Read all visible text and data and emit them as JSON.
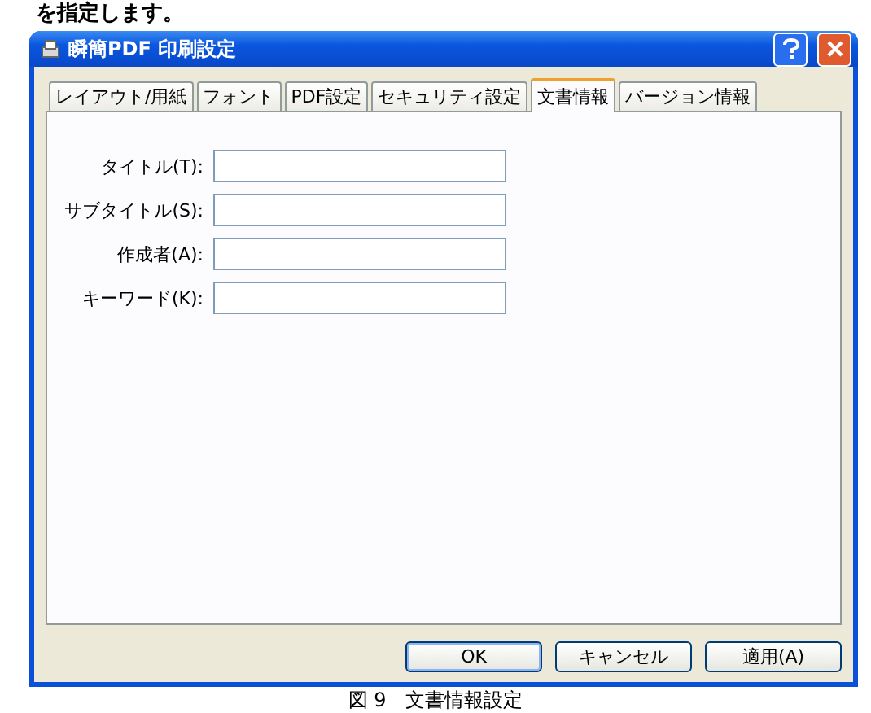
{
  "intro_text": "を指定します。",
  "window": {
    "title": "瞬簡PDF 印刷設定"
  },
  "tabs": [
    {
      "label": "レイアウト/用紙",
      "selected": false
    },
    {
      "label": "フォント",
      "selected": false
    },
    {
      "label": "PDF設定",
      "selected": false
    },
    {
      "label": "セキュリティ設定",
      "selected": false
    },
    {
      "label": "文書情報",
      "selected": true
    },
    {
      "label": "バージョン情報",
      "selected": false
    }
  ],
  "fields": [
    {
      "label": "タイトル(T):"
    },
    {
      "label": "サブタイトル(S):"
    },
    {
      "label": "作成者(A):"
    },
    {
      "label": "キーワード(K):"
    }
  ],
  "buttons": [
    "OK",
    "キャンセル",
    "適用(A)"
  ],
  "caption": "図 9　文書情報設定"
}
